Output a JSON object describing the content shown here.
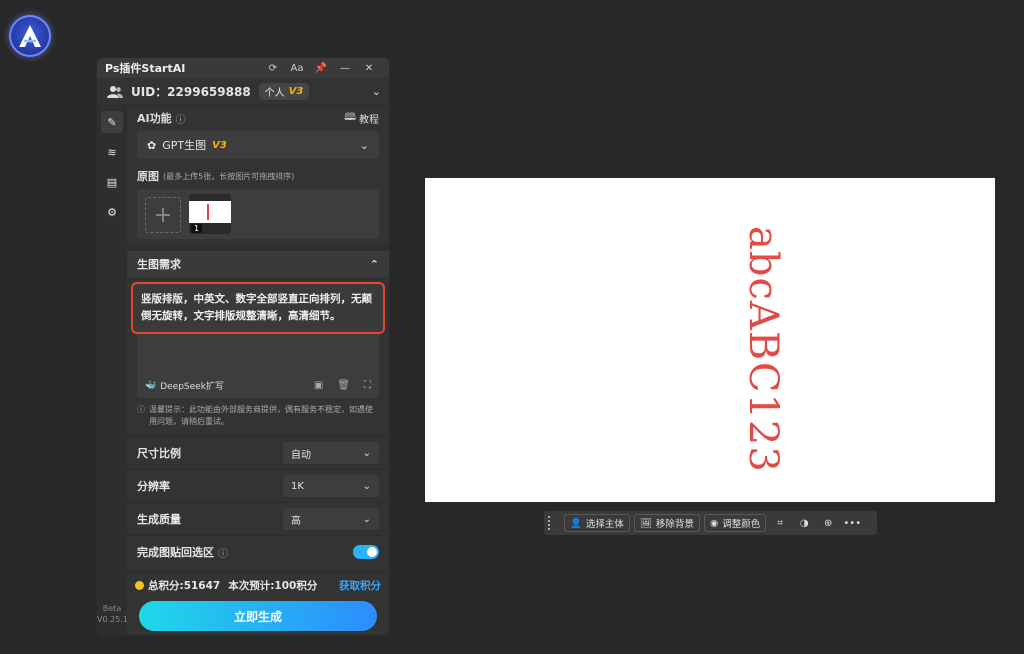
{
  "header": {
    "title": "Ps插件StartAI",
    "uid_label": "UID：2299659888",
    "plan_label": "个人",
    "plan_version": "V3"
  },
  "rail": {
    "beta_label": "Beta",
    "version": "V0.25.1"
  },
  "ai_function": {
    "label": "AI功能",
    "tutorial_label": "教程",
    "selected": "GPT生图",
    "selected_version": "V3"
  },
  "original": {
    "label": "原图",
    "hint": "(最多上传5张，长按图片可拖拽排序)",
    "thumb_index": "1"
  },
  "generation": {
    "label": "生图需求",
    "prompt": "竖版排版，中英文、数字全部竖直正向排列，无颠倒无旋转，文字排版规整清晰，高清细节。",
    "deepseek_label": "DeepSeek扩写",
    "tip": "温馨提示：此功能由外部服务商提供，偶有服务不稳定，如遇使用问题，请稍后重试。"
  },
  "settings": [
    {
      "label": "尺寸比例",
      "value": "自动"
    },
    {
      "label": "分辨率",
      "value": "1K"
    },
    {
      "label": "生成质量",
      "value": "高"
    }
  ],
  "paste_back": {
    "label": "完成图贴回选区",
    "enabled": true
  },
  "footer": {
    "points_text": "总积分:51647",
    "estimate_text": "本次预计:100积分",
    "get_points": "获取积分",
    "generate_label": "立即生成"
  },
  "canvas": {
    "text": "abcABC123",
    "text_color": "#e24a44"
  },
  "float_toolbar": {
    "select_subject": "选择主体",
    "remove_background": "移除背景",
    "adjust_color": "调整颜色"
  },
  "colors": {
    "accent": "#2ab3ff",
    "highlight": "#e2472d",
    "badge_gold": "#f4b400"
  }
}
